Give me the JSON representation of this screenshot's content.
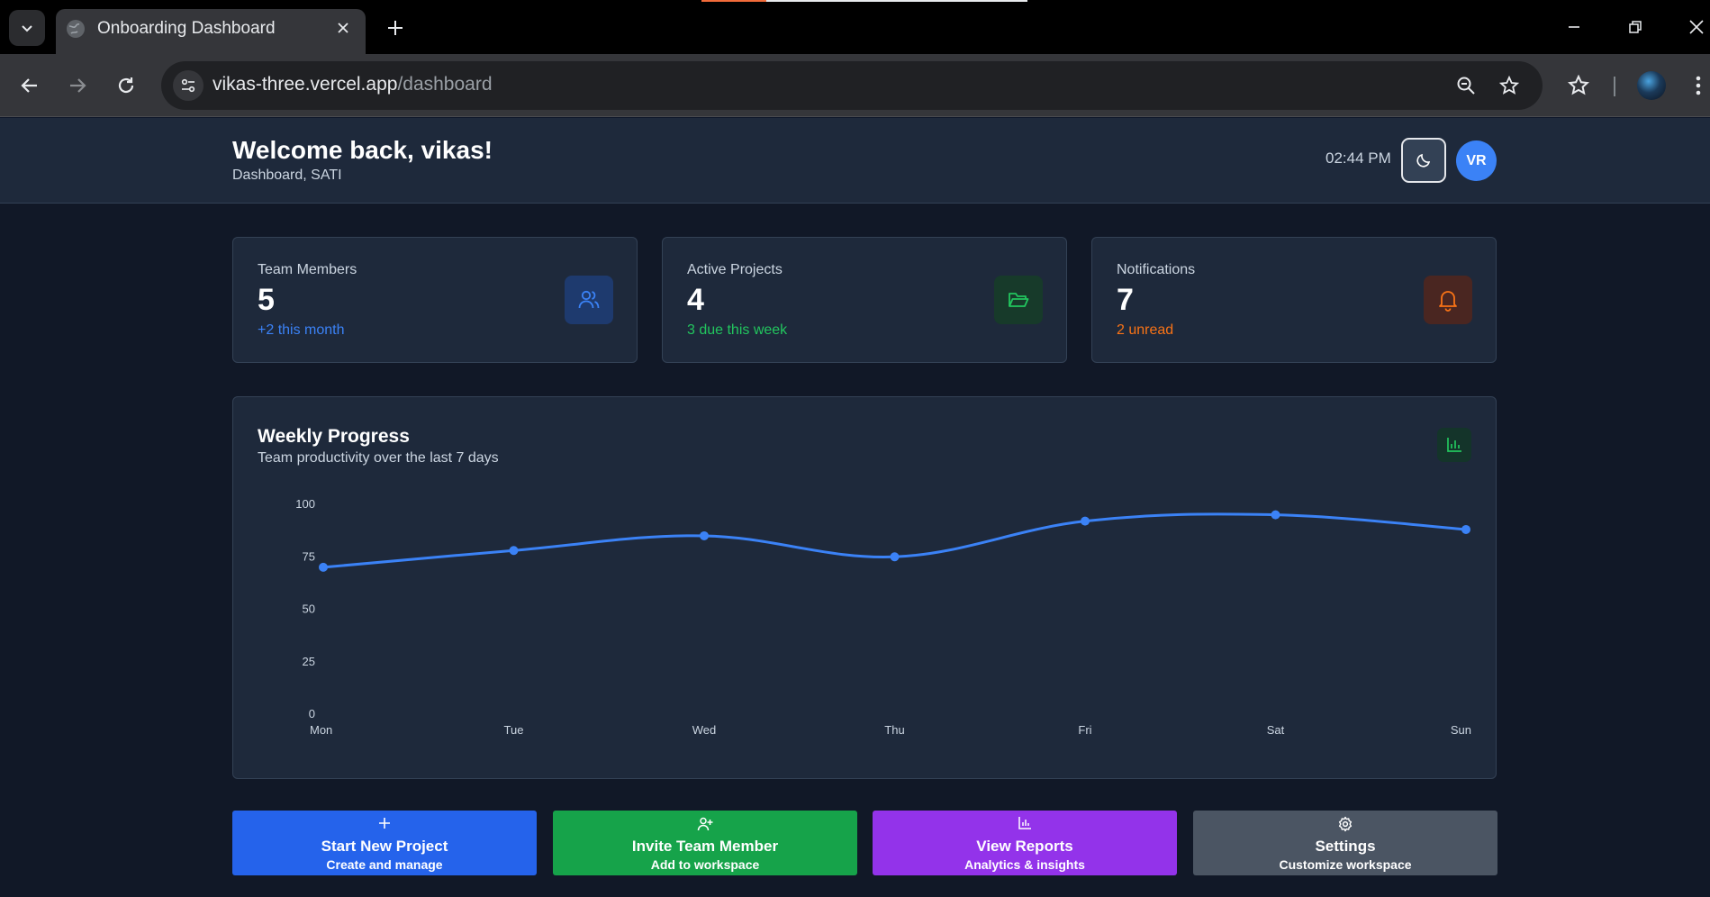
{
  "browser": {
    "tab_title": "Onboarding Dashboard",
    "url_host": "vikas-three.vercel.app",
    "url_path": "/dashboard"
  },
  "header": {
    "welcome": "Welcome back, vikas!",
    "subtitle": "Dashboard, SATI",
    "time": "02:44 PM",
    "avatar_initials": "VR"
  },
  "stats": [
    {
      "label": "Team Members",
      "value": "5",
      "note": "+2 this month",
      "color": "#3b82f6",
      "icon": "users-icon"
    },
    {
      "label": "Active Projects",
      "value": "4",
      "note": "3 due this week",
      "color": "#22c55e",
      "icon": "folder-open-icon"
    },
    {
      "label": "Notifications",
      "value": "7",
      "note": "2 unread",
      "color": "#f97316",
      "icon": "bell-icon"
    }
  ],
  "chart": {
    "title": "Weekly Progress",
    "subtitle": "Team productivity over the last 7 days"
  },
  "chart_data": {
    "type": "line",
    "categories": [
      "Mon",
      "Tue",
      "Wed",
      "Thu",
      "Fri",
      "Sat",
      "Sun"
    ],
    "series": [
      {
        "values": [
          70,
          78,
          85,
          75,
          92,
          95,
          88
        ],
        "color": "#3b82f6"
      }
    ],
    "yticks": [
      "0",
      "25",
      "50",
      "75",
      "100"
    ],
    "ylim": [
      0,
      100
    ],
    "smooth": true,
    "grid": false
  },
  "actions": [
    {
      "title": "Start New Project",
      "sub": "Create and manage",
      "color": "#2563eb",
      "icon": "plus-icon"
    },
    {
      "title": "Invite Team Member",
      "sub": "Add to workspace",
      "color": "#16a34a",
      "icon": "user-plus-icon"
    },
    {
      "title": "View Reports",
      "sub": "Analytics & insights",
      "color": "#9333ea",
      "icon": "bar-chart-icon"
    },
    {
      "title": "Settings",
      "sub": "Customize workspace",
      "color": "#4b5563",
      "icon": "gear-icon"
    }
  ]
}
